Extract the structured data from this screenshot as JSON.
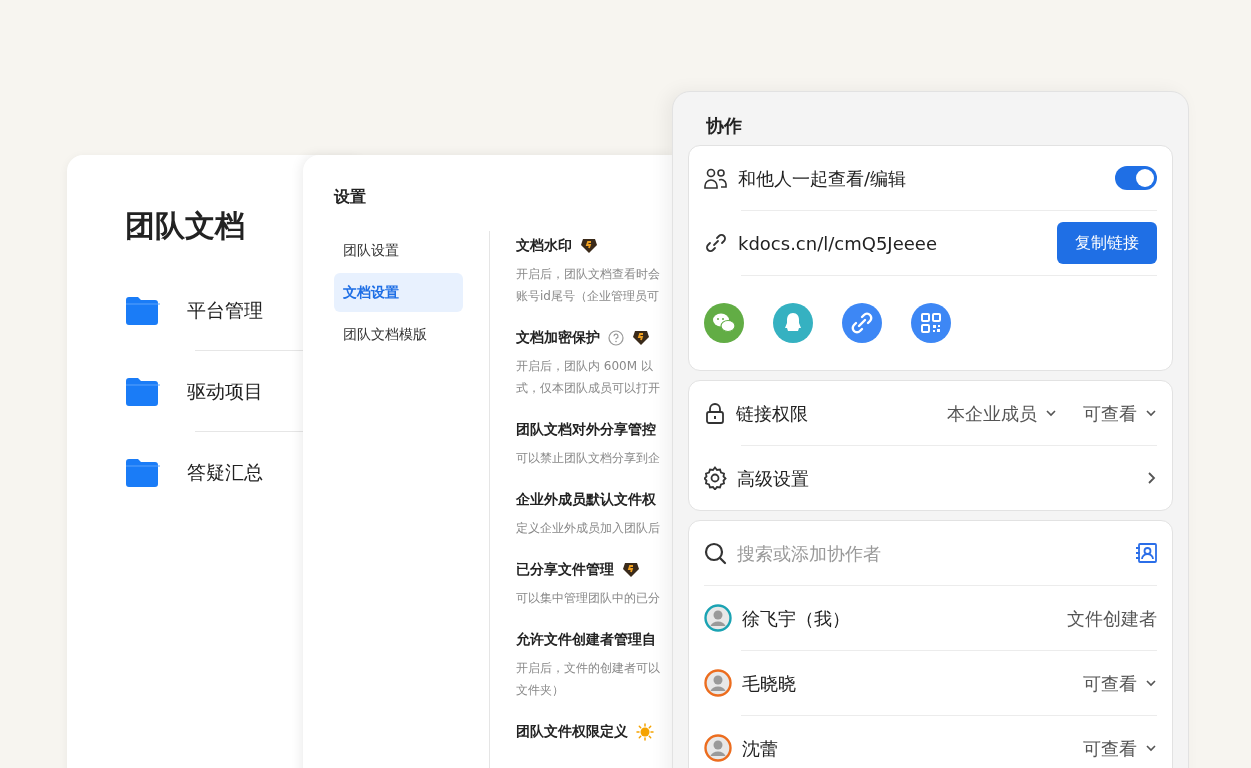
{
  "team_docs": {
    "title": "团队文档",
    "folders": [
      {
        "name": "平台管理"
      },
      {
        "name": "驱动项目"
      },
      {
        "name": "答疑汇总"
      }
    ]
  },
  "settings": {
    "title": "设置",
    "nav": [
      {
        "label": "团队设置",
        "selected": false
      },
      {
        "label": "文档设置",
        "selected": true
      },
      {
        "label": "团队文档模版",
        "selected": false
      }
    ],
    "items": [
      {
        "title": "文档水印",
        "badges": [
          {
            "kind": "vip"
          }
        ],
        "description": [
          "开启后，团队文档查看时会",
          "账号id尾号（企业管理员可"
        ]
      },
      {
        "title": "文档加密保护",
        "badges": [
          {
            "kind": "help"
          },
          {
            "kind": "vip"
          }
        ],
        "description": [
          "开启后，团队内 600M 以",
          "式，仅本团队成员可以打开"
        ]
      },
      {
        "title": "团队文档对外分享管控",
        "description": [
          "可以禁止团队文档分享到企"
        ]
      },
      {
        "title": "企业外成员默认文件权",
        "description": [
          "定义企业外成员加入团队后"
        ]
      },
      {
        "title": "已分享文件管理",
        "badges": [
          {
            "kind": "vip"
          }
        ],
        "description": [
          "可以集中管理团队中的已分"
        ]
      },
      {
        "title": "允许文件创建者管理自",
        "description": [
          "开启后，文件的创建者可以",
          "文件夹）"
        ]
      },
      {
        "title": "团队文件权限定义",
        "badges": [
          {
            "kind": "sun"
          }
        ]
      }
    ]
  },
  "collab": {
    "title": "协作",
    "share": {
      "label": "和他人一起查看/编辑",
      "on": true
    },
    "link": {
      "url": "kdocs.cn/l/cmQ5Jeeee",
      "copy_button": "复制链接"
    },
    "share_targets": [
      {
        "kind": "wechat"
      },
      {
        "kind": "qq"
      },
      {
        "kind": "link"
      },
      {
        "kind": "qrcode"
      }
    ],
    "link_permission": {
      "label": "链接权限",
      "scope": "本企业成员",
      "access": "可查看"
    },
    "advanced": {
      "label": "高级设置"
    },
    "search": {
      "placeholder": "搜索或添加协作者"
    },
    "members": [
      {
        "name": "徐飞宇（我）",
        "role": "文件创建者",
        "dropdown": false,
        "color": "#1ba3b3"
      },
      {
        "name": "毛晓晓",
        "role": "可查看",
        "dropdown": true,
        "color": "#ec6d1f"
      },
      {
        "name": "沈蕾",
        "role": "可查看",
        "dropdown": true,
        "color": "#ec6d1f"
      }
    ]
  }
}
